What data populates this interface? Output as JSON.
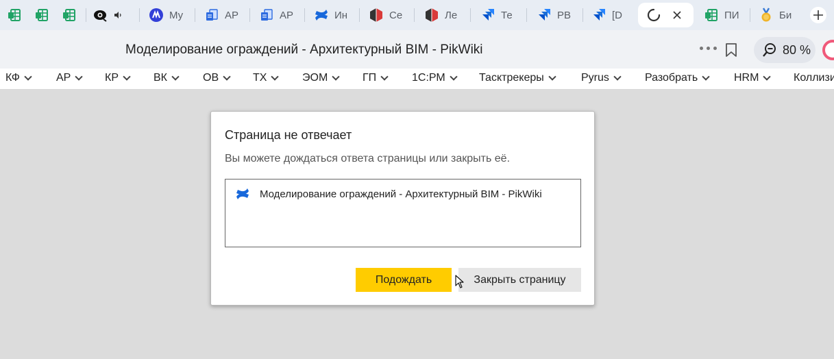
{
  "tabs": [
    {
      "icon": "spreadsheet-icon",
      "title": ""
    },
    {
      "icon": "spreadsheet-icon",
      "title": ""
    },
    {
      "icon": "spreadsheet-icon",
      "title": ""
    },
    {
      "icon": "eye-icon",
      "title": ""
    },
    {
      "icon": "music-logo-icon",
      "title": "Му"
    },
    {
      "icon": "document-icon",
      "title": "АР"
    },
    {
      "icon": "document-icon",
      "title": "АР"
    },
    {
      "icon": "confluence-icon",
      "title": "Ин"
    },
    {
      "icon": "cube-logo-icon",
      "title": "Се"
    },
    {
      "icon": "cube-logo-icon",
      "title": "Ле"
    },
    {
      "icon": "jira-icon",
      "title": "Те"
    },
    {
      "icon": "jira-icon",
      "title": "РВ"
    },
    {
      "icon": "jira-icon",
      "title": "[D"
    },
    {
      "icon": "loading-spinner-icon",
      "title": ""
    },
    {
      "icon": "spreadsheet-icon",
      "title": "ПИ"
    },
    {
      "icon": "medal-icon",
      "title": "Би"
    }
  ],
  "colors": {
    "accent_yellow": "#ffcc00",
    "tab_green": "#21a366",
    "jira_blue": "#2684ff",
    "confluence_blue": "#1868db",
    "cube_red": "#d93a3a",
    "music_blue": "#3340d8"
  },
  "address_bar": {
    "page_title": "Моделирование ограждений - Архитектурный BIM - PikWiki",
    "zoom": "80 %"
  },
  "bookmarks": [
    {
      "label": "КФ"
    },
    {
      "label": "АР"
    },
    {
      "label": "КР"
    },
    {
      "label": "ВК"
    },
    {
      "label": "ОВ"
    },
    {
      "label": "ТХ"
    },
    {
      "label": "ЭОМ"
    },
    {
      "label": "ГП"
    },
    {
      "label": "1С:РМ"
    },
    {
      "label": "Тасктрекеры"
    },
    {
      "label": "Pyrus"
    },
    {
      "label": "Разобрать"
    },
    {
      "label": "HRM"
    },
    {
      "label": "Коллизи"
    }
  ],
  "dialog": {
    "title": "Страница не отвечает",
    "message": "Вы можете дождаться ответа страницы или закрыть её.",
    "list_item": "Моделирование ограждений - Архитектурный BIM - PikWiki",
    "wait_button": "Подождать",
    "close_button": "Закрыть страницу"
  }
}
